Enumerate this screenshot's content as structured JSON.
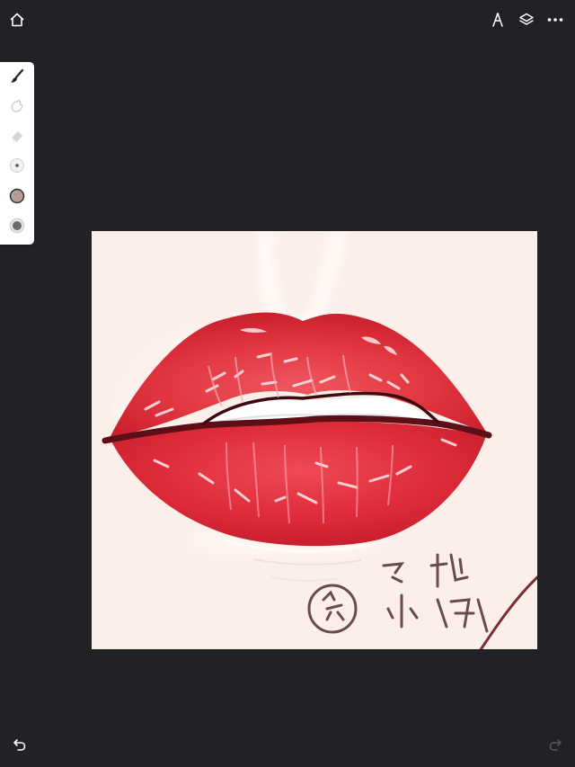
{
  "app": {
    "colors": {
      "background": "#212225",
      "toolbar": "#ffffff",
      "icon_active": "#ffffff",
      "icon_disabled": "#55565a",
      "current_color": "#b89c99",
      "canvas_bg": "#fcefe9",
      "lip_red": "#e0323e",
      "lip_dark": "#5c0f16"
    }
  },
  "header": {
    "home_icon": "home-icon",
    "ruler_icon": "compass-ruler-icon",
    "layers_icon": "layers-icon",
    "more_icon": "more-icon"
  },
  "toolbar": {
    "tools": [
      {
        "icon": "brush-icon",
        "state": "active"
      },
      {
        "icon": "smudge-icon",
        "state": "inactive"
      },
      {
        "icon": "eraser-icon",
        "state": "inactive"
      },
      {
        "icon": "brush-size-icon",
        "state": "inactive"
      },
      {
        "icon": "color-swatch-icon",
        "state": "active"
      },
      {
        "icon": "opacity-icon",
        "state": "inactive"
      }
    ]
  },
  "canvas": {
    "signature_text": "绘 飞扎小娜"
  },
  "footer": {
    "undo_icon": "undo-icon",
    "redo_icon": "redo-icon",
    "redo_enabled": false
  }
}
